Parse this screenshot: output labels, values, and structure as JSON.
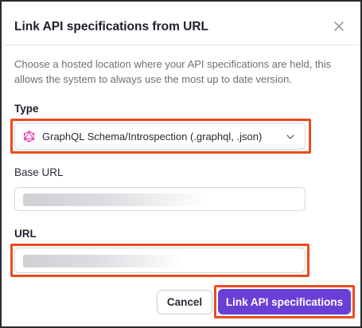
{
  "dialog": {
    "title": "Link API specifications from URL",
    "description": "Choose a hosted location where your API specifications are held, this allows the system to always use the most up to date version."
  },
  "type_field": {
    "label": "Type",
    "selected": "GraphQL Schema/Introspection (.graphql, .json)",
    "icon": "graphql-icon"
  },
  "base_url_field": {
    "label": "Base URL"
  },
  "url_field": {
    "label": "URL"
  },
  "buttons": {
    "cancel": "Cancel",
    "submit": "Link API specifications"
  },
  "colors": {
    "primary": "#6a3fd6",
    "highlight": "#ec4b1c",
    "graphql": "#e535ab"
  }
}
